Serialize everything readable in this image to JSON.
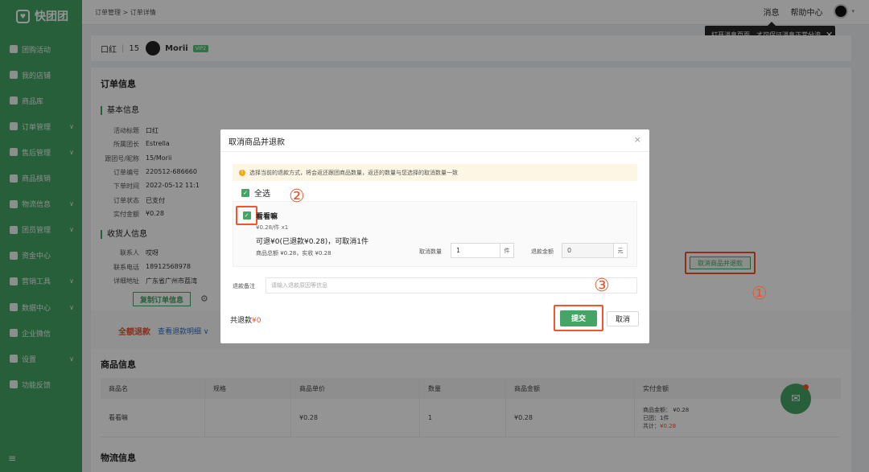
{
  "app": {
    "logo_text": "快团团",
    "logo_icon": "heart-icon"
  },
  "sidebar": {
    "items": [
      {
        "label": "团购活动",
        "icon": "cart-icon",
        "has_children": false
      },
      {
        "label": "我的店铺",
        "icon": "store-icon",
        "has_children": false
      },
      {
        "label": "商品库",
        "icon": "box-icon",
        "has_children": false
      },
      {
        "label": "订单管理",
        "icon": "order-icon",
        "has_children": true
      },
      {
        "label": "售后管理",
        "icon": "aftersale-icon",
        "has_children": true
      },
      {
        "label": "商品核销",
        "icon": "verify-icon",
        "has_children": false
      },
      {
        "label": "物流信息",
        "icon": "truck-icon",
        "has_children": true
      },
      {
        "label": "团员管理",
        "icon": "user-icon",
        "has_children": true
      },
      {
        "label": "资金中心",
        "icon": "money-icon",
        "has_children": false
      },
      {
        "label": "营销工具",
        "icon": "tag-icon",
        "has_children": true
      },
      {
        "label": "数据中心",
        "icon": "chart-icon",
        "has_children": true
      },
      {
        "label": "企业微信",
        "icon": "wechat-icon",
        "has_children": false
      },
      {
        "label": "设置",
        "icon": "gear-icon",
        "has_children": true
      },
      {
        "label": "功能反馈",
        "icon": "edit-icon",
        "has_children": false
      }
    ],
    "bottom_icon": "≡"
  },
  "topbar": {
    "breadcrumb": "订单管理 > 订单详情",
    "messages": "消息",
    "help": "帮助中心",
    "avatar_caret": "▾"
  },
  "tooltip": {
    "text": "打开消息页面，才可保证消息正常分流",
    "close": "✕"
  },
  "header": {
    "product": "口红",
    "count": "15",
    "user": "Morii",
    "vip": "VIP2"
  },
  "order": {
    "section_title": "订单信息",
    "basic_title": "基本信息",
    "fields": [
      {
        "k": "活动标题",
        "v": "口红"
      },
      {
        "k": "所属团长",
        "v": "Estrella"
      },
      {
        "k": "跟团号/昵称",
        "v": "15/Morii"
      },
      {
        "k": "订单编号",
        "v": "220512-686660"
      },
      {
        "k": "下单时间",
        "v": "2022-05-12 11:1"
      },
      {
        "k": "订单状态",
        "v": "已支付"
      },
      {
        "k": "实付金额",
        "v": "¥0.28"
      }
    ],
    "receiver_title": "收货人信息",
    "receiver": [
      {
        "k": "联系人",
        "v": "哎呀"
      },
      {
        "k": "联系电话",
        "v": "18912568978"
      },
      {
        "k": "详细地址",
        "v": "广东省广州市荔湾"
      }
    ],
    "copy_btn": "复制订单信息",
    "gear": "⚙"
  },
  "refund_bar": {
    "full_refund": "全额退款",
    "view_detail": "查看退款明细 ∨",
    "cancel_btn": "取消商品并退款"
  },
  "goods": {
    "title": "商品信息",
    "headers": [
      "商品名",
      "规格",
      "商品单价",
      "数量",
      "商品金额",
      "实付金额"
    ],
    "row": {
      "name": "看看嘛",
      "spec": "",
      "price": "¥0.28",
      "qty": "1",
      "amount": "¥0.28",
      "pay_l1": "商品金额： ¥0.28",
      "pay_l2": "已团：1件",
      "pay_l3a": "共计：",
      "pay_l3b": "¥0.28"
    }
  },
  "logistics_title": "物流信息",
  "fab": {
    "icon": "mail-icon",
    "glyph": "✉"
  },
  "annotations": {
    "n1": "①",
    "n2": "②",
    "n3": "③"
  },
  "modal": {
    "title": "取消商品并退款",
    "close": "×",
    "warning": "选择当前的退款方式，将会返还跟团商品数量，返还的数量与您选择的取消数量一致",
    "warn_icon": "!",
    "select_all": "全选",
    "check": "✓",
    "item": {
      "name": "看看嘛",
      "price": "¥0.28/件 x1",
      "refundable": "可退¥0(已退款¥0.28)，可取消1件",
      "total": "商品总额 ¥0.28，实收 ¥0.28"
    },
    "qty_label": "取消数量",
    "qty_value": "1",
    "qty_unit": "件",
    "amount_label": "退款金额",
    "amount_value": "0",
    "amount_unit": "元",
    "remark_label": "退款备注",
    "remark_placeholder": "请输入退款原因等信息",
    "total_label": "共退款",
    "total_value": "¥0",
    "submit": "提交",
    "cancel": "取消"
  }
}
